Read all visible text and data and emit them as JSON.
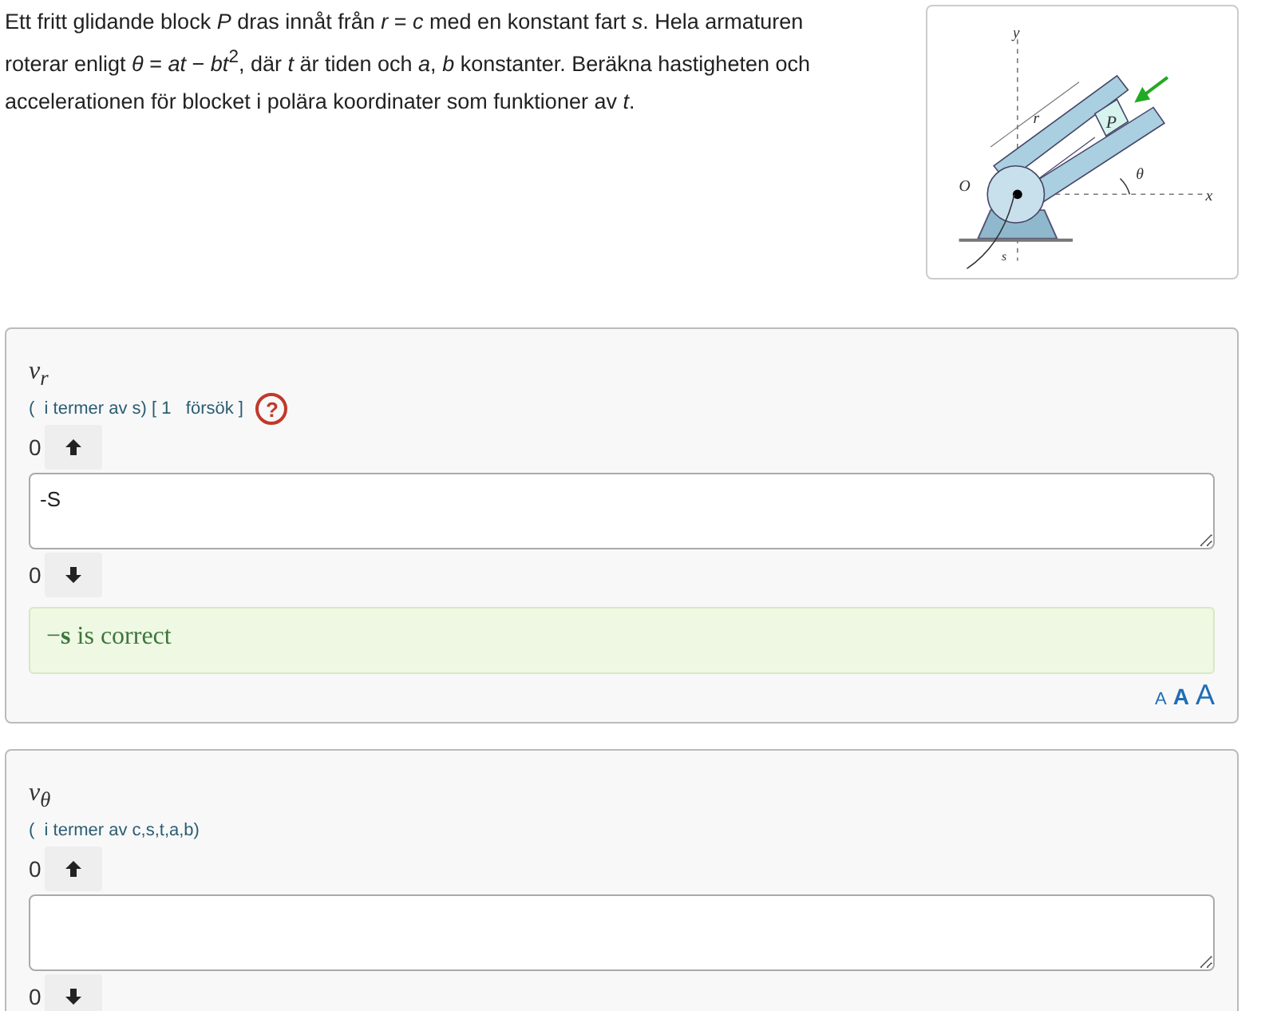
{
  "problem": {
    "text": "Ett fritt glidande block *P* dras innåt från *r* = *c* med en konstant fart *s*. Hela armaturen roterar enligt *θ* = *at* − *bt*$^{2}$, där *t* är tiden och *a*, *b* konstanter. Beräkna hastigheten och accelerationen för blocket i polära koordinater som funktioner av *t*."
  },
  "figure": {
    "labels": {
      "y": "y",
      "r": "r",
      "p": "P",
      "theta": "θ",
      "o": "O",
      "x": "x",
      "s": "s"
    }
  },
  "questions": [
    {
      "label": "*v*$_{r}$",
      "hint": "(  i termer av s) [ 1   försök ]",
      "help_icon": "?",
      "up_count": "0",
      "value": "-S",
      "down_count": "0",
      "feedback": {
        "kind": "correct",
        "text": "−**s** is correct"
      },
      "font_sizes": [
        "A",
        "A",
        "A"
      ]
    },
    {
      "label": "*v*$_{θ}$",
      "hint": "(  i termer av c,s,t,a,b)",
      "up_count": "0",
      "down_count": "0"
    }
  ]
}
